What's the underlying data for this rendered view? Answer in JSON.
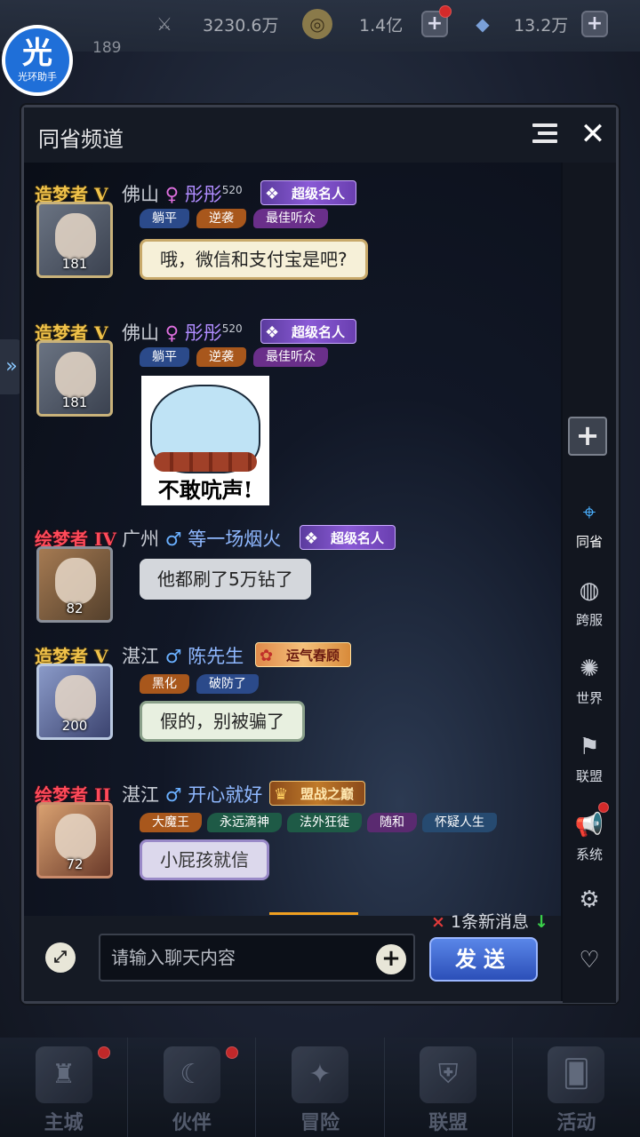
{
  "top_bar": {
    "power": "3230.6万",
    "gold": "1.4亿",
    "diamonds": "13.2万",
    "player_level": "189"
  },
  "helper": {
    "glyph": "光",
    "label": "光环助手"
  },
  "panel": {
    "title": "同省频道",
    "close_glyph": "✕"
  },
  "messages": [
    {
      "rank": "造梦者 V",
      "city": "佛山",
      "gender": "♀",
      "nick": "彤彤",
      "nick_sup": "520",
      "title": "超级名人",
      "avatar_level": "181",
      "tags": [
        "躺平",
        "逆袭",
        "最佳听众"
      ],
      "text": "哦，微信和支付宝是吧?"
    },
    {
      "rank": "造梦者 V",
      "city": "佛山",
      "gender": "♀",
      "nick": "彤彤",
      "nick_sup": "520",
      "title": "超级名人",
      "avatar_level": "181",
      "tags": [
        "躺平",
        "逆袭",
        "最佳听众"
      ],
      "sticker_caption": "不敢吭声!"
    },
    {
      "rank": "绘梦者 IV",
      "city": "广州",
      "gender": "♂",
      "nick": "等一场烟火",
      "title": "超级名人",
      "avatar_level": "82",
      "text": "他都刷了5万钻了"
    },
    {
      "rank": "造梦者 V",
      "city": "湛江",
      "gender": "♂",
      "nick": "陈先生",
      "title": "运气春顾",
      "avatar_level": "200",
      "tags": [
        "黑化",
        "破防了"
      ],
      "text": "假的，别被骗了"
    },
    {
      "rank": "绘梦者 II",
      "city": "湛江",
      "gender": "♂",
      "nick": "开心就好",
      "title": "盟战之巅",
      "avatar_level": "72",
      "tags": [
        "大魔王",
        "永远滴神",
        "法外狂徒",
        "随和",
        "怀疑人生"
      ],
      "text": "小屁孩就信"
    }
  ],
  "input": {
    "placeholder": "请输入聊天内容",
    "send_label": "发送",
    "new_messages": "1条新消息"
  },
  "sidebar": {
    "items": [
      {
        "label": "同省",
        "icon": "location-pin-icon"
      },
      {
        "label": "跨服",
        "icon": "planet-icon"
      },
      {
        "label": "世界",
        "icon": "compass-icon"
      },
      {
        "label": "联盟",
        "icon": "banner-icon"
      },
      {
        "label": "系统",
        "icon": "megaphone-icon"
      }
    ]
  },
  "bottom_nav": {
    "items": [
      {
        "label": "主城",
        "icon": "castle-icon"
      },
      {
        "label": "伙伴",
        "icon": "partner-icon"
      },
      {
        "label": "冒险",
        "icon": "adventure-icon"
      },
      {
        "label": "联盟",
        "icon": "alliance-icon"
      },
      {
        "label": "活动",
        "icon": "cards-icon"
      }
    ]
  },
  "colors": {
    "accent_blue": "#4ab0ff",
    "send_button": "#2c4fb8",
    "rank_gold": "#f0c24a",
    "rank_red": "#ff4a5a"
  }
}
